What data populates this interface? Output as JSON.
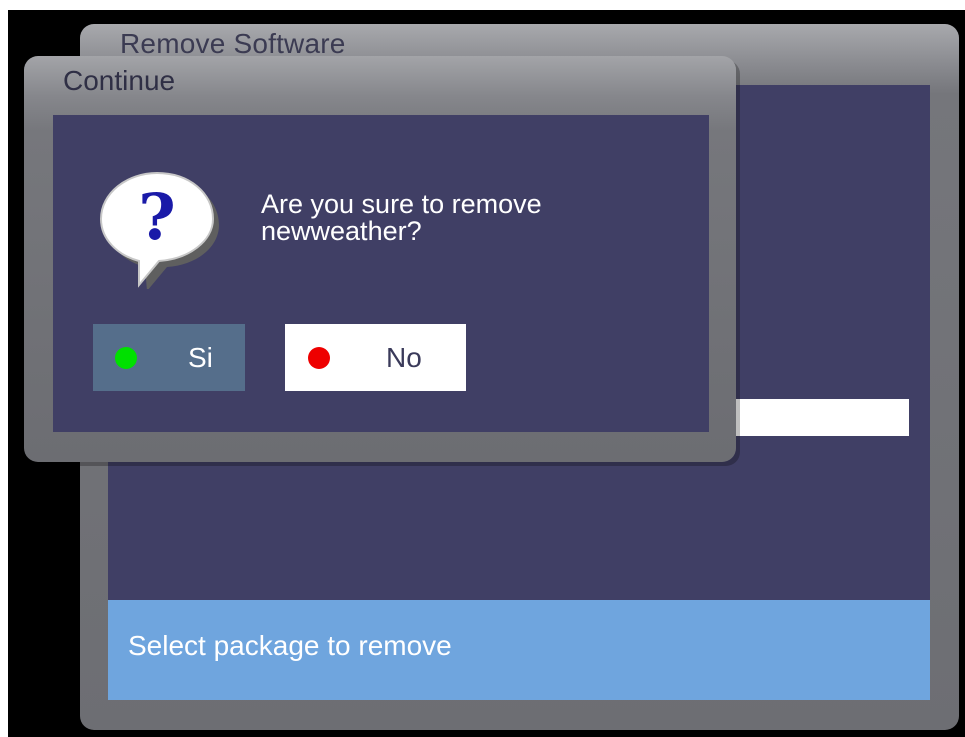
{
  "background_window": {
    "title": "Remove Software",
    "status_text": "Select package to remove"
  },
  "dialog": {
    "title": "Continue",
    "message_line1": "Are you sure to remove",
    "message_line2": "newweather?",
    "icon": "question-balloon-icon",
    "buttons": {
      "yes_label": "Si",
      "yes_indicator_color": "#00e000",
      "no_label": "No",
      "no_indicator_color": "#ee0000"
    }
  },
  "colors": {
    "content_bg": "#403f65",
    "status_bar_bg": "#6fa5de",
    "selected_button_bg": "#556e8b"
  }
}
